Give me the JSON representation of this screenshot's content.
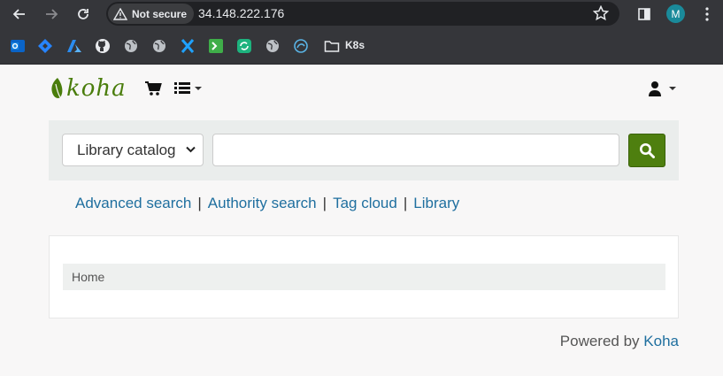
{
  "browser": {
    "security_label": "Not secure",
    "url": "34.148.222.176",
    "profile_initial": "M",
    "bookmark_folder": "K8s"
  },
  "header": {
    "logo_text": "koha",
    "cart_icon": "cart-icon",
    "lists_icon": "list-icon",
    "user_icon": "user-icon"
  },
  "search": {
    "scope_selected": "Library catalog",
    "query_value": "",
    "submit_icon": "search-icon"
  },
  "links": {
    "advanced": "Advanced search",
    "authority": "Authority search",
    "tagcloud": "Tag cloud",
    "library": "Library",
    "separator": "|"
  },
  "breadcrumb": {
    "home": "Home"
  },
  "footer": {
    "powered_by": "Powered by",
    "koha": "Koha"
  },
  "colors": {
    "brand_green": "#4e7f0f",
    "link_blue": "#1f6f9f"
  }
}
